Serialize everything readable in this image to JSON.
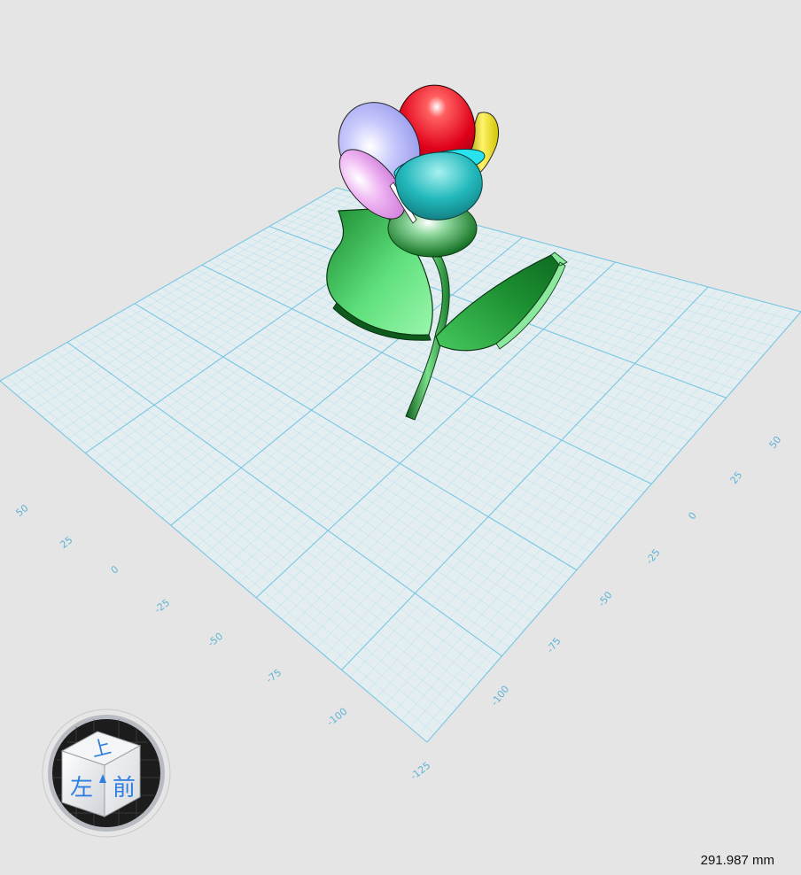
{
  "viewport": {
    "scale_readout": "291.987 mm",
    "axis_left_labels": [
      "50",
      "25",
      "0",
      "-25",
      "-50",
      "-75",
      "-100",
      "-125"
    ],
    "axis_right_labels": [
      "50",
      "25",
      "0",
      "-25",
      "-50",
      "-75",
      "-100"
    ],
    "colors": {
      "background": "#e5e5e5",
      "grid": "#8fd3ea",
      "grid_major": "#6cc2e2",
      "petal_red": "#e0001a",
      "petal_yellow": "#e8dc00",
      "petal_lavender": "#aeb0f8",
      "petal_pink": "#e9a6f0",
      "petal_teal": "#1fb5b8",
      "leaf_green": "#22a83c",
      "stem_green": "#1e8c30"
    }
  },
  "view_cube": {
    "top_face": "上",
    "left_face": "左",
    "front_face": "前",
    "icon": "view-cube-icon"
  }
}
